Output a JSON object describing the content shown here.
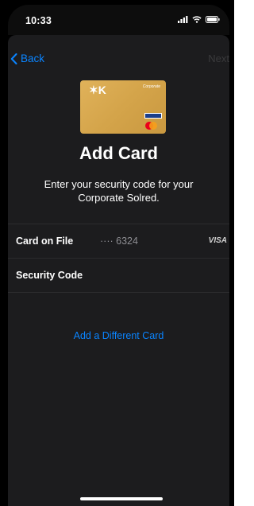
{
  "status": {
    "time": "10:33"
  },
  "nav": {
    "back_label": "Back",
    "next_label": "Next"
  },
  "card": {
    "brand": "Corporate"
  },
  "header": {
    "title": "Add Card",
    "subtitle": "Enter your security code for your Corporate Solred."
  },
  "rows": {
    "card_on_file_label": "Card on File",
    "card_dots": "···· 6324",
    "card_network": "VISA",
    "security_code_label": "Security Code"
  },
  "link": {
    "label": "Add a Different Card"
  },
  "colors": {
    "accent": "#0a84ff",
    "background": "#1c1c1e",
    "card_gold": "#d4a44a"
  }
}
